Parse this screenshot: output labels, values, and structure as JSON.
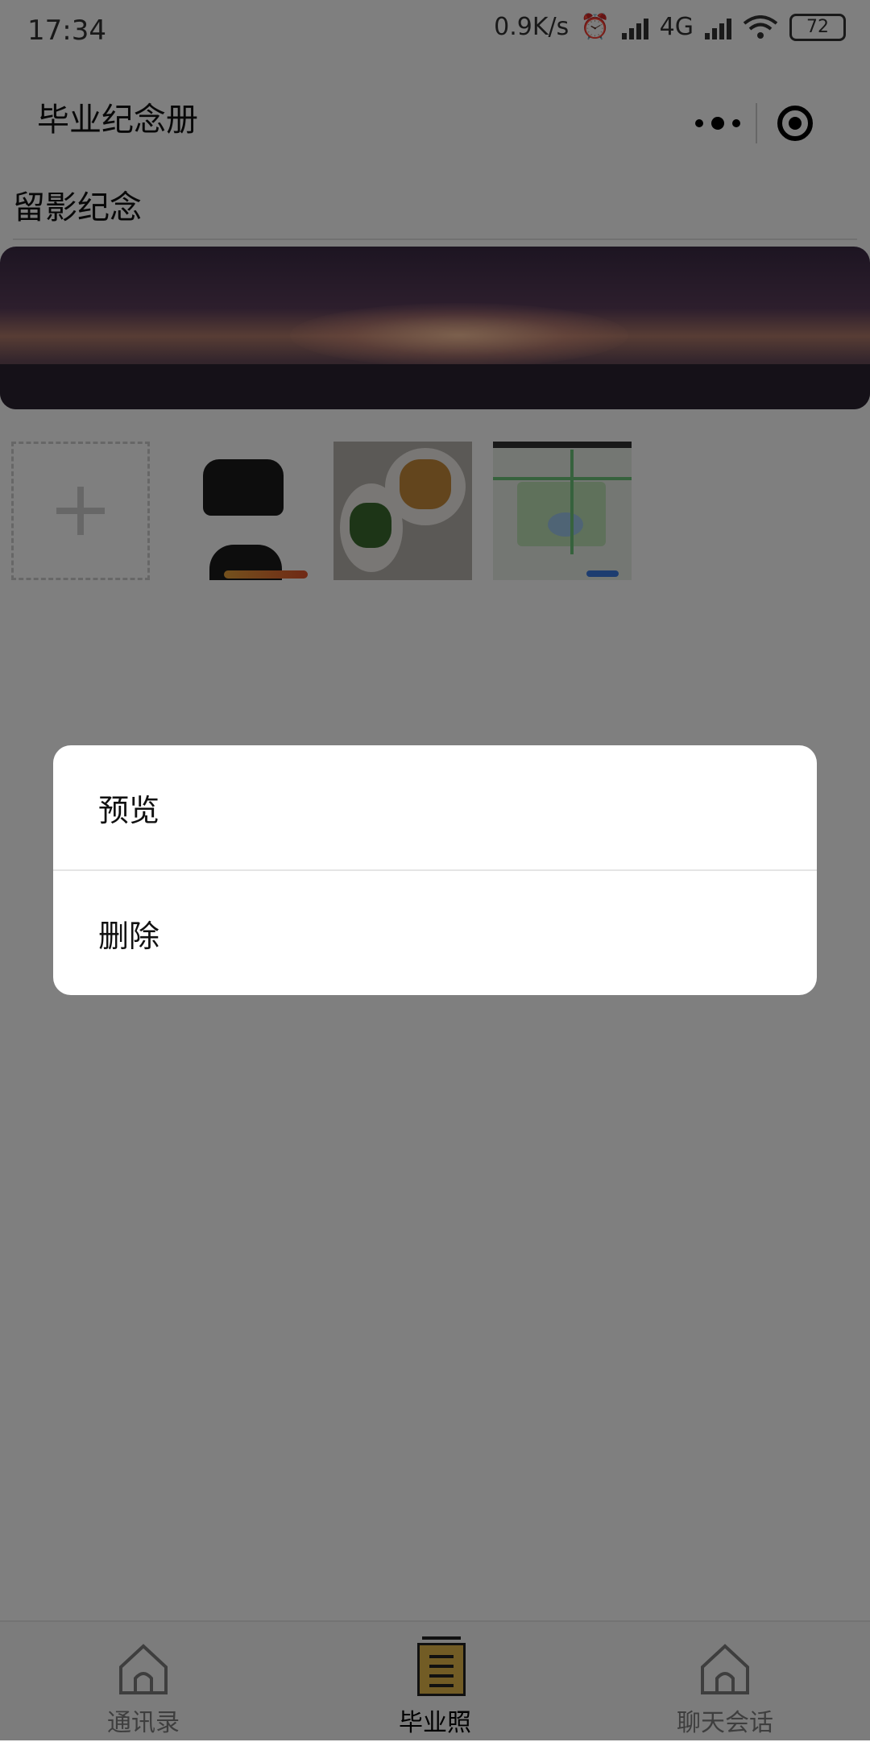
{
  "status_bar": {
    "time": "17:34",
    "speed": "0.9K/s",
    "network": "4G",
    "battery": "72"
  },
  "nav": {
    "title": "毕业纪念册",
    "more_icon": "more-dots-icon",
    "target_icon": "target-icon"
  },
  "section": {
    "title": "留影纪念"
  },
  "photos": {
    "add_icon": "plus-icon",
    "items": [
      "hoodie-screenshot",
      "food-photo",
      "map-screenshot"
    ]
  },
  "action_sheet": {
    "items": [
      "预览",
      "删除"
    ]
  },
  "tabbar": {
    "active_color": "#e4b84a",
    "items": [
      {
        "label": "通讯录",
        "icon": "house-icon"
      },
      {
        "label": "毕业照",
        "icon": "document-icon"
      },
      {
        "label": "聊天会话",
        "icon": "house-icon"
      }
    ]
  }
}
